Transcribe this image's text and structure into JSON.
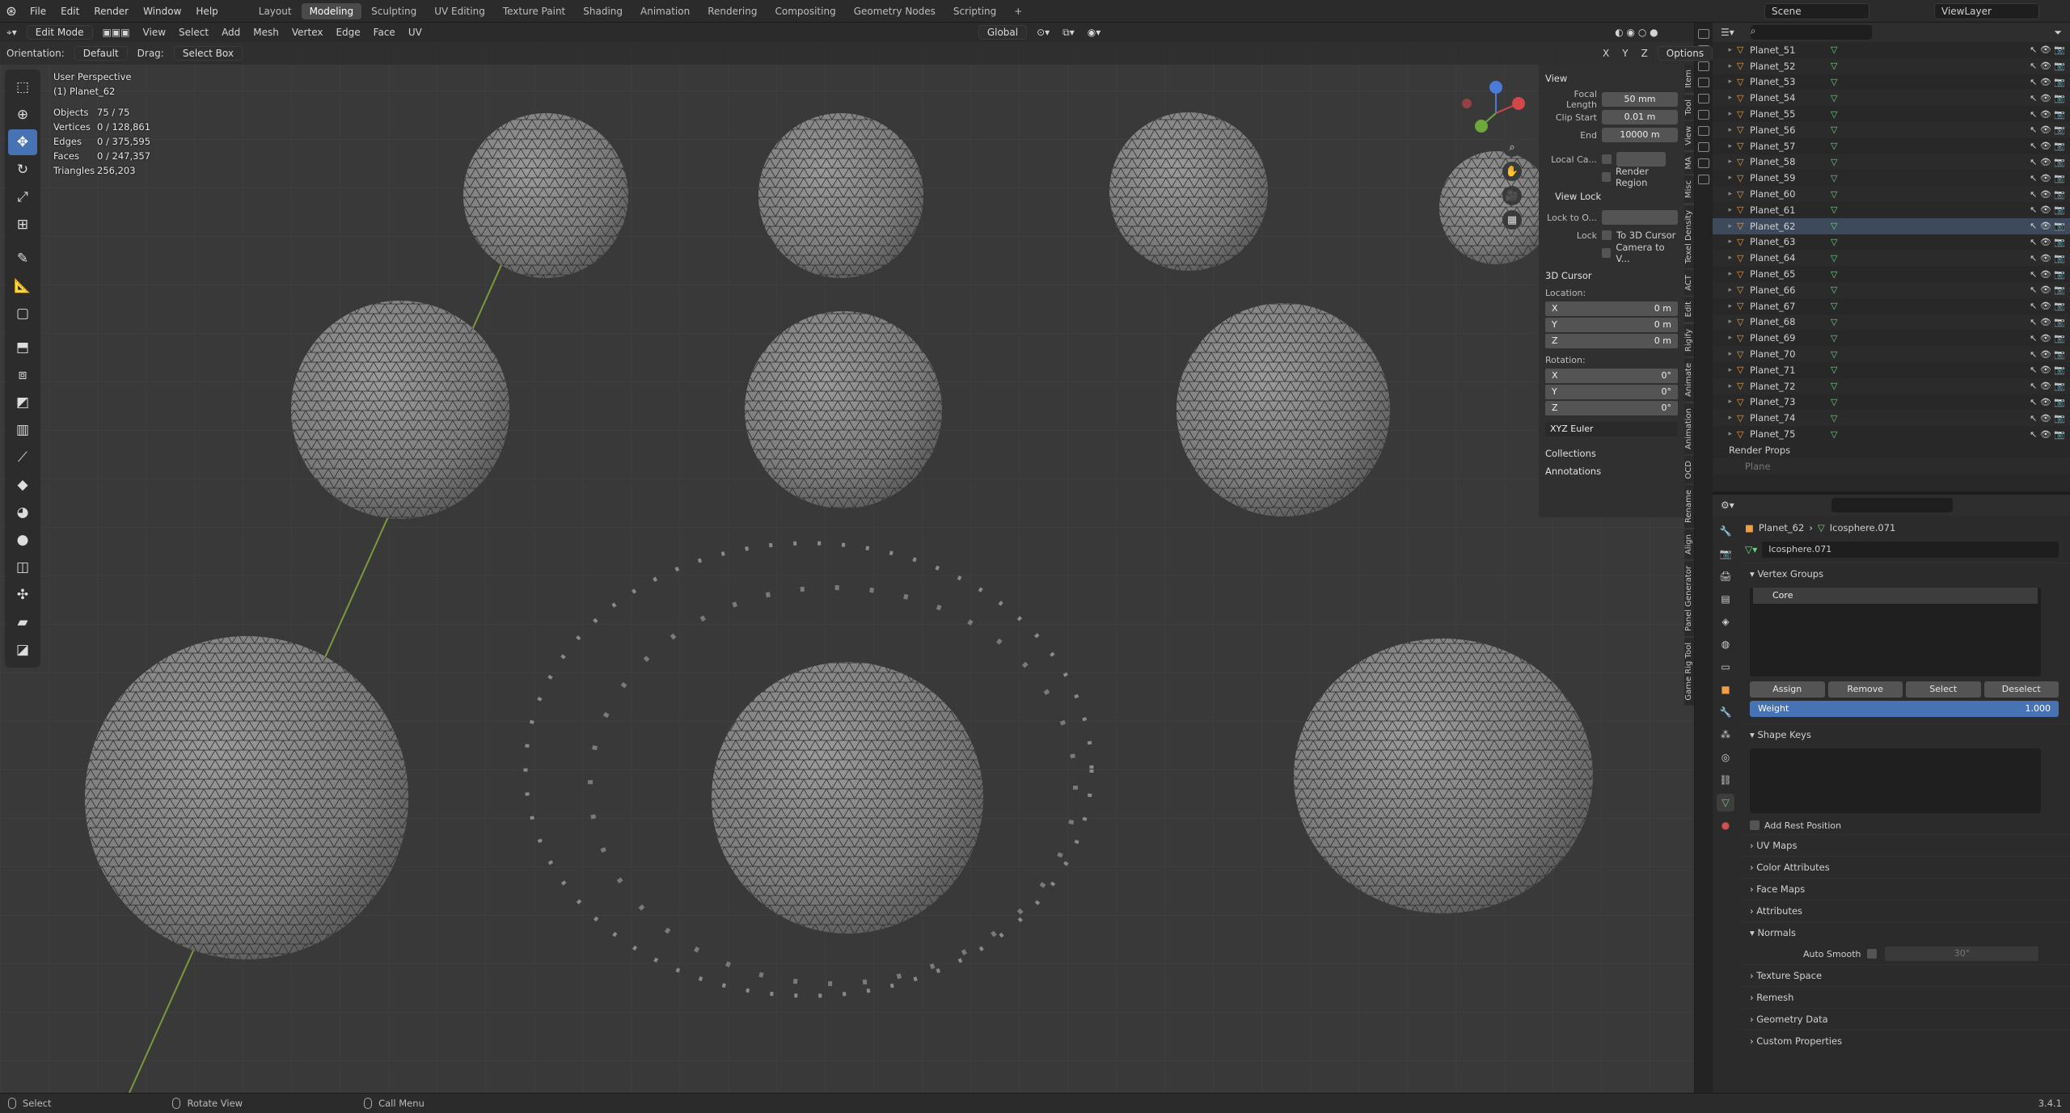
{
  "menus": [
    "File",
    "Edit",
    "Render",
    "Window",
    "Help"
  ],
  "workspaces": [
    "Layout",
    "Modeling",
    "Sculpting",
    "UV Editing",
    "Texture Paint",
    "Shading",
    "Animation",
    "Rendering",
    "Compositing",
    "Geometry Nodes",
    "Scripting",
    "+"
  ],
  "active_workspace": "Modeling",
  "scene": "Scene",
  "view_layer": "ViewLayer",
  "header": {
    "mode": "Edit Mode",
    "menu": [
      "View",
      "Select",
      "Add",
      "Mesh",
      "Vertex",
      "Edge",
      "Face",
      "UV"
    ],
    "transform": "Global",
    "orientation_label": "Orientation:",
    "orientation": "Default",
    "drag_label": "Drag:",
    "drag": "Select Box",
    "axes": [
      "X",
      "Y",
      "Z"
    ],
    "options": "Options"
  },
  "overlay": {
    "view": "User Perspective",
    "object": "(1) Planet_62",
    "stats": [
      {
        "label": "Objects",
        "value": "75 / 75"
      },
      {
        "label": "Vertices",
        "value": "0 / 128,861"
      },
      {
        "label": "Edges",
        "value": "0 / 375,595"
      },
      {
        "label": "Faces",
        "value": "0 / 247,357"
      },
      {
        "label": "Triangles",
        "value": "256,203"
      }
    ]
  },
  "npanel": {
    "view_title": "View",
    "focal_label": "Focal Length",
    "focal": "50 mm",
    "clip_start_label": "Clip Start",
    "clip_start": "0.01 m",
    "end_label": "End",
    "end": "10000 m",
    "local_cam": "Local Ca...",
    "render_region": "Render Region",
    "view_lock": "View Lock",
    "lock_to": "Lock to O...",
    "lock": "Lock",
    "to_cursor": "To 3D Cursor",
    "camera_to_view": "Camera to V...",
    "cursor_title": "3D Cursor",
    "location": "Location:",
    "rotation": "Rotation:",
    "loc": [
      {
        "a": "X",
        "v": "0 m"
      },
      {
        "a": "Y",
        "v": "0 m"
      },
      {
        "a": "Z",
        "v": "0 m"
      }
    ],
    "rot": [
      {
        "a": "X",
        "v": "0°"
      },
      {
        "a": "Y",
        "v": "0°"
      },
      {
        "a": "Z",
        "v": "0°"
      }
    ],
    "euler": "XYZ Euler",
    "collections": "Collections",
    "annotations": "Annotations"
  },
  "vtabs": [
    "Item",
    "Tool",
    "View",
    "MA",
    "Misc",
    "Texel Density",
    "ACT",
    "Edit",
    "Rigify",
    "Animate",
    "Animation",
    "OCD",
    "Rename",
    "Align",
    "Panel Generator",
    "Game Rig Tool"
  ],
  "outliner": {
    "planets": [
      "Planet_51",
      "Planet_52",
      "Planet_53",
      "Planet_54",
      "Planet_55",
      "Planet_56",
      "Planet_57",
      "Planet_58",
      "Planet_59",
      "Planet_60",
      "Planet_61",
      "Planet_62",
      "Planet_63",
      "Planet_64",
      "Planet_65",
      "Planet_66",
      "Planet_67",
      "Planet_68",
      "Planet_69",
      "Planet_70",
      "Planet_71",
      "Planet_72",
      "Planet_73",
      "Planet_74",
      "Planet_75"
    ],
    "selected": "Planet_62",
    "render_props": "Render Props",
    "plane": "Plane"
  },
  "properties": {
    "object": "Planet_62",
    "mesh": "Icosphere.071",
    "vertex_groups": "Vertex Groups",
    "group": "Core",
    "assign": "Assign",
    "remove": "Remove",
    "select": "Select",
    "deselect": "Deselect",
    "weight_label": "Weight",
    "weight": "1.000",
    "shape_keys": "Shape Keys",
    "add_rest": "Add Rest Position",
    "sections": [
      "UV Maps",
      "Color Attributes",
      "Face Maps",
      "Attributes"
    ],
    "normals": "Normals",
    "auto_smooth": "Auto Smooth",
    "angle": "30°",
    "sections2": [
      "Texture Space",
      "Remesh",
      "Geometry Data",
      "Custom Properties"
    ]
  },
  "status": {
    "select": "Select",
    "rotate": "Rotate View",
    "call_menu": "Call Menu",
    "version": "3.4.1"
  },
  "colors": {
    "accent": "#4772b3",
    "object": "#f0a040",
    "mesh": "#6fd18c"
  }
}
